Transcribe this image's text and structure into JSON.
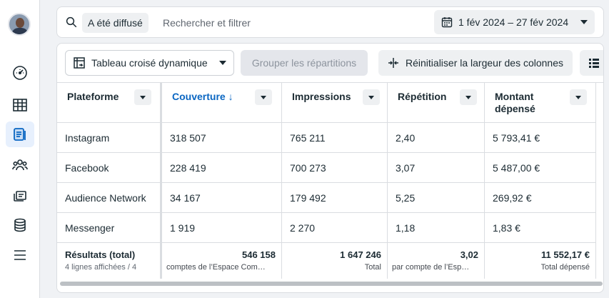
{
  "search": {
    "filter_chip": "A été diffusé",
    "placeholder": "Rechercher et filtrer"
  },
  "date_range": "1 fév 2024 – 27 fév 2024",
  "toolbar": {
    "pivot_label": "Tableau croisé dynamique",
    "group_label": "Grouper les répartitions",
    "reset_label": "Réinitialiser la largeur des colonnes"
  },
  "table": {
    "headers": {
      "platform": "Plateforme",
      "coverage": "Couverture ↓",
      "impressions": "Impressions",
      "repetition": "Répétition",
      "spend_line1": "Montant",
      "spend_line2": "dépensé"
    },
    "rows": [
      {
        "platform": "Instagram",
        "coverage": "318 507",
        "impressions": "765 211",
        "repetition": "2,40",
        "spend": "5 793,41 €"
      },
      {
        "platform": "Facebook",
        "coverage": "228 419",
        "impressions": "700 273",
        "repetition": "3,07",
        "spend": "5 487,00 €"
      },
      {
        "platform": "Audience Network",
        "coverage": "34 167",
        "impressions": "179 492",
        "repetition": "5,25",
        "spend": "269,92 €"
      },
      {
        "platform": "Messenger",
        "coverage": "1 919",
        "impressions": "2 270",
        "repetition": "1,18",
        "spend": "1,83 €"
      }
    ],
    "totals": {
      "label": "Résultats (total)",
      "sublabel": "4 lignes affichées / 4",
      "coverage": "546 158",
      "coverage_sub": "comptes de l’Espace Com…",
      "impressions": "1 647 246",
      "impressions_sub": "Total",
      "repetition": "3,02",
      "repetition_sub": "par compte de l’Esp…",
      "spend": "11 552,17 €",
      "spend_sub": "Total dépensé"
    }
  },
  "colors": {
    "accent": "#0a66c2",
    "active_nav_bg": "#e7f0fd"
  }
}
